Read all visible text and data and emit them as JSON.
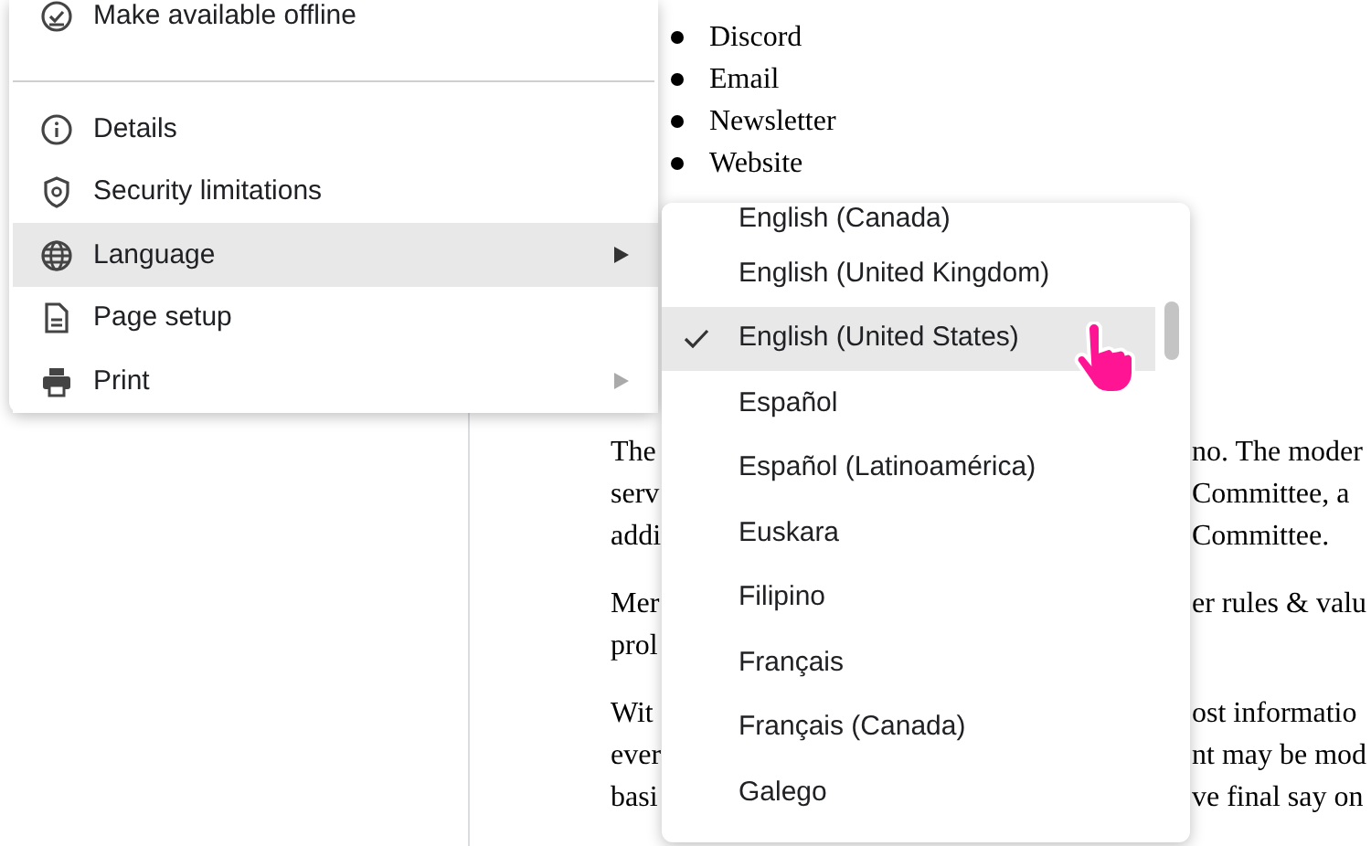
{
  "document": {
    "bullets": [
      "Discord",
      "Email",
      "Newsletter",
      "Website"
    ],
    "paragraphs": [
      {
        "lines": [
          {
            "left": "The",
            "right": "no. The moder"
          },
          {
            "left": "serv",
            "right": "Committee, a"
          },
          {
            "left": "addi",
            "right": "Committee."
          }
        ]
      },
      {
        "lines": [
          {
            "left": "Mer",
            "right": "er rules & valu"
          },
          {
            "left": "prol"
          }
        ]
      },
      {
        "lines": [
          {
            "left": "Wit",
            "right": "ost informatio"
          },
          {
            "left": "ever",
            "right": "nt may be mod"
          },
          {
            "left": "basi",
            "right": "ve final say on"
          }
        ]
      }
    ]
  },
  "file_menu": {
    "items": [
      {
        "kind": "item",
        "label": "Make available offline",
        "highlighted": false,
        "has_submenu": false
      },
      {
        "kind": "divider"
      },
      {
        "kind": "item",
        "label": "Details",
        "highlighted": false,
        "has_submenu": false
      },
      {
        "kind": "item",
        "label": "Security limitations",
        "highlighted": false,
        "has_submenu": false
      },
      {
        "kind": "item",
        "label": "Language",
        "highlighted": true,
        "has_submenu": true
      },
      {
        "kind": "item",
        "label": "Page setup",
        "highlighted": false,
        "has_submenu": false
      },
      {
        "kind": "item",
        "label": "Print",
        "highlighted": false,
        "has_submenu": true
      }
    ]
  },
  "language_menu": {
    "items": [
      {
        "label": "English (Canada)",
        "checked": false,
        "highlighted": false
      },
      {
        "label": "English (United Kingdom)",
        "checked": false,
        "highlighted": false
      },
      {
        "label": "English (United States)",
        "checked": true,
        "highlighted": true
      },
      {
        "label": "Español",
        "checked": false,
        "highlighted": false
      },
      {
        "label": "Español (Latinoamérica)",
        "checked": false,
        "highlighted": false
      },
      {
        "label": "Euskara",
        "checked": false,
        "highlighted": false
      },
      {
        "label": "Filipino",
        "checked": false,
        "highlighted": false
      },
      {
        "label": "Français",
        "checked": false,
        "highlighted": false
      },
      {
        "label": "Français (Canada)",
        "checked": false,
        "highlighted": false
      },
      {
        "label": "Galego",
        "checked": false,
        "highlighted": false
      }
    ]
  }
}
